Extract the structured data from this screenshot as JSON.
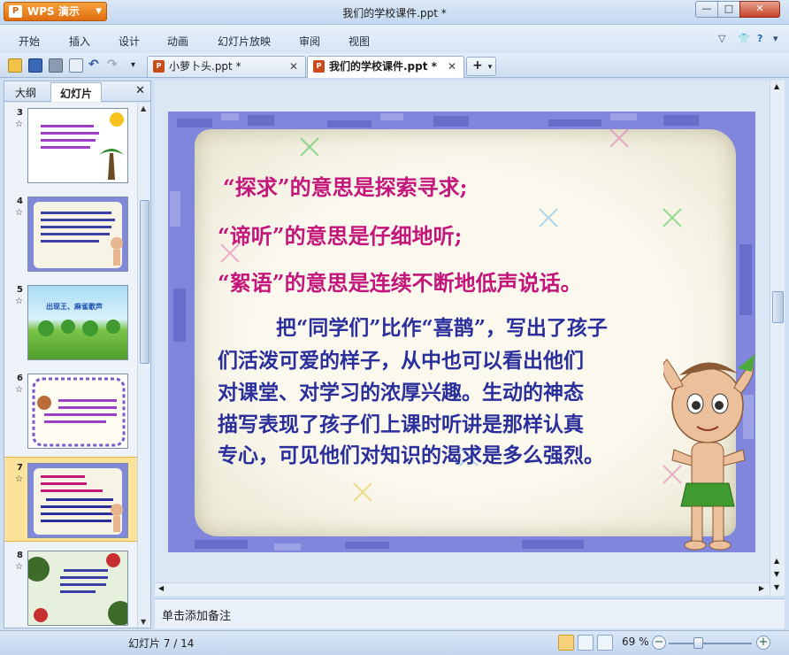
{
  "app": {
    "button_label": "WPS 演示",
    "window_title": "我们的学校课件.ppt *"
  },
  "menu": {
    "items": [
      "开始",
      "插入",
      "设计",
      "动画",
      "幻灯片放映",
      "审阅",
      "视图"
    ]
  },
  "tabs": [
    {
      "label": "小萝卜头.ppt *",
      "active": false
    },
    {
      "label": "我们的学校课件.ppt *",
      "active": true
    }
  ],
  "left_panel": {
    "tabs": [
      "大纲",
      "幻灯片"
    ],
    "active_tab": "幻灯片",
    "thumbnails": [
      {
        "number": "3",
        "selected": false
      },
      {
        "number": "4",
        "selected": false
      },
      {
        "number": "5",
        "selected": false
      },
      {
        "number": "6",
        "selected": false
      },
      {
        "number": "7",
        "selected": true
      },
      {
        "number": "8",
        "selected": false
      }
    ],
    "thumb5_text": "出现王、麻雀歌声"
  },
  "slide": {
    "lines": [
      "“探求”的意思是探索寻求;",
      "“谛听”的意思是仔细地听;",
      "“絮语”的意思是连续不断地低声说话。"
    ],
    "paragraph": [
      "把“同学们”比作“喜鹊”，写出了孩子",
      "们活泼可爱的样子，从中也可以看出他们",
      "对课堂、对学习的浓厚兴趣。生动的神态",
      "描写表现了孩子们上课时听讲是那样认真",
      "专心，可见他们对知识的渴求是多么强烈。"
    ]
  },
  "notes_placeholder": "单击添加备注",
  "status": {
    "slide_indicator": "幻灯片 7 / 14",
    "zoom": "69 %"
  },
  "colors": {
    "accent_orange": "#e06d10",
    "slide_pink": "#c4157a",
    "slide_blue": "#2a2f9c",
    "selection": "#fbe39b"
  }
}
